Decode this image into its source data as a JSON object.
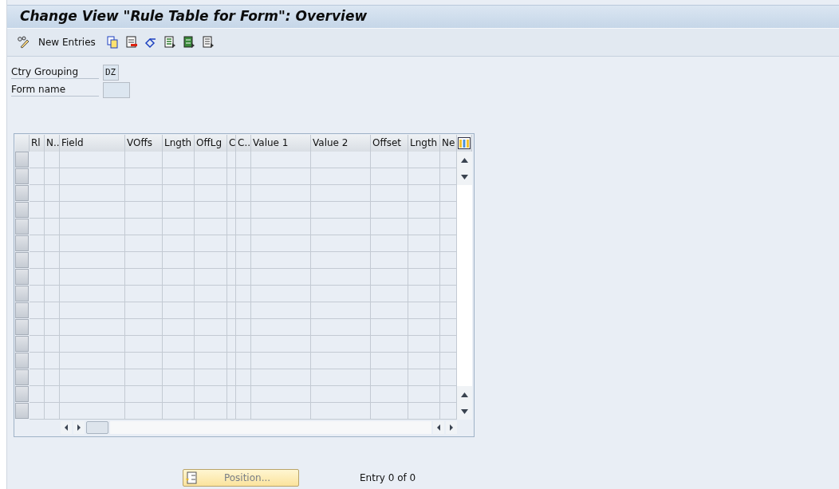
{
  "window": {
    "title": "Change View \"Rule Table for Form\": Overview"
  },
  "toolbar": {
    "new_entries": "New Entries"
  },
  "fields": [
    {
      "label": "Ctry Grouping",
      "value": "DZ"
    },
    {
      "label": "Form name"
    }
  ],
  "table": {
    "columns": [
      "Rl",
      "N..",
      "Field",
      "VOffs",
      "Lngth",
      "OffLg",
      "C",
      "C..",
      "Value 1",
      "Value 2",
      "Offset",
      "Lngth",
      "Ne"
    ]
  },
  "footer": {
    "position_button": {
      "label": "Position...",
      "disabled": true
    },
    "entry_count": "Entry 0 of 0"
  }
}
